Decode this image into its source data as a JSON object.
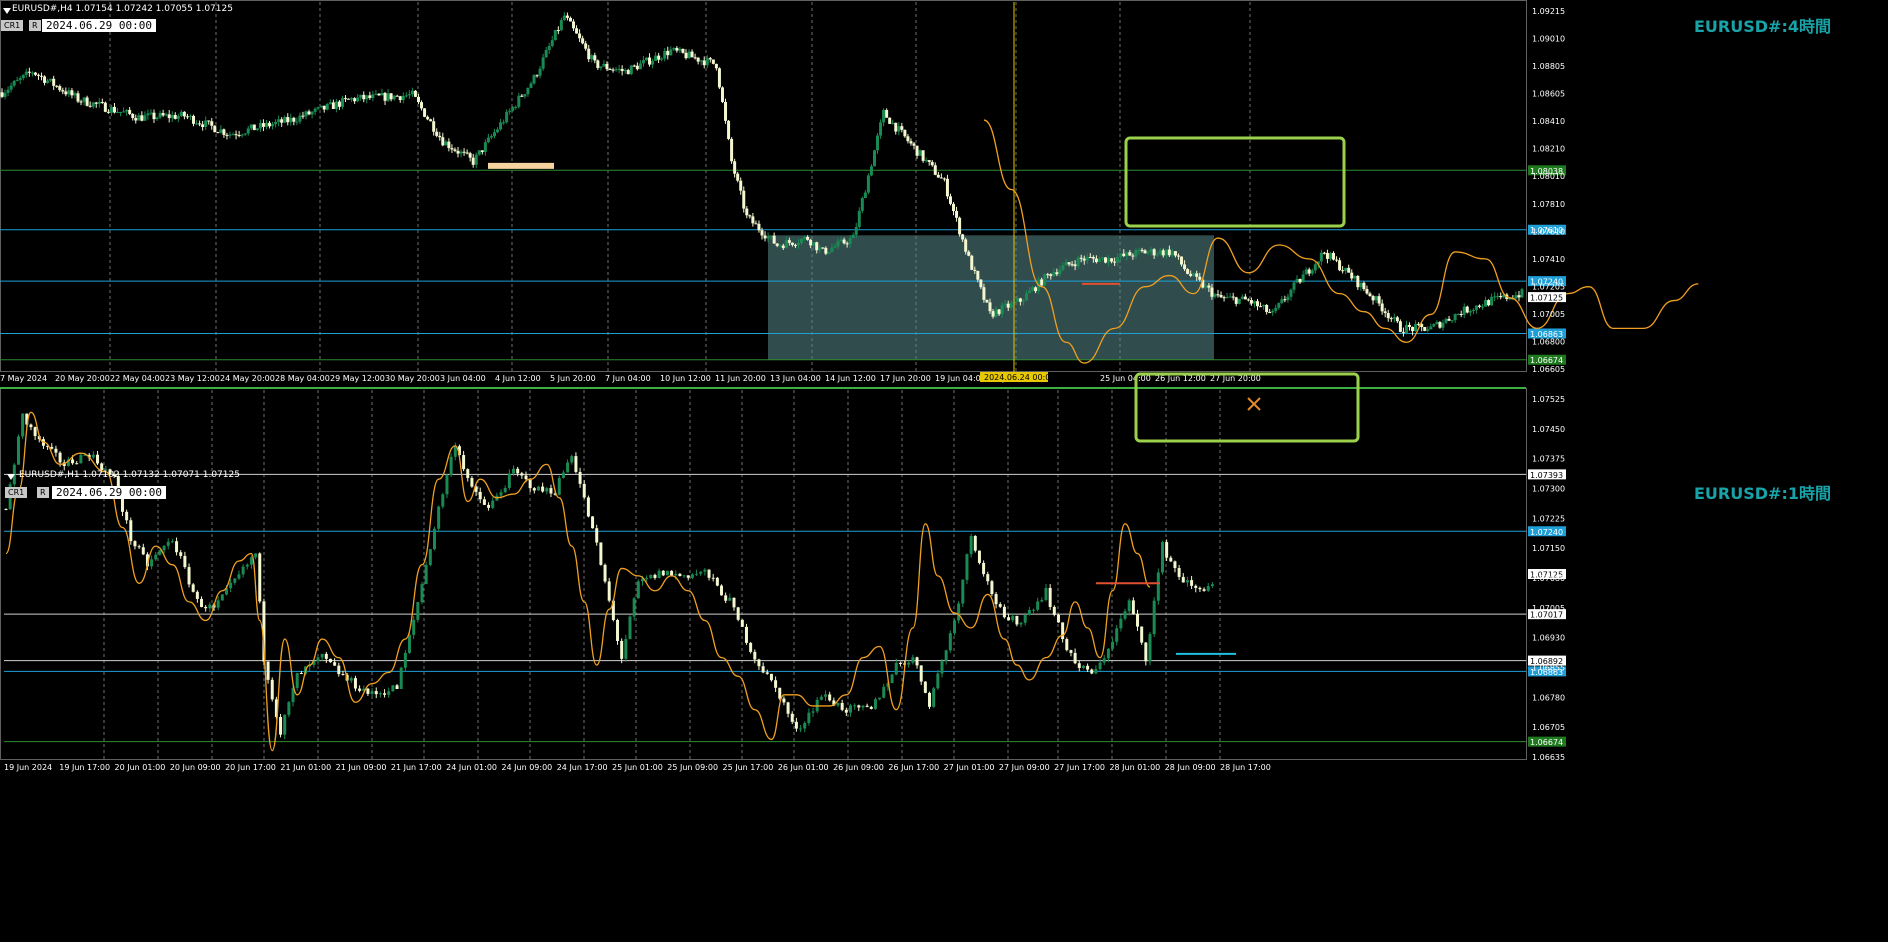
{
  "colors": {
    "background": "#000000",
    "bull": "#1a8a54",
    "bear": "#f4f7d0",
    "grid": "#8a8a8a",
    "blue_level": "#1e9fd8",
    "green_level": "#2e8b2e",
    "white_level": "#d0d0d0",
    "smooth_line": "#f0a020",
    "zone_box": "#9bd04a",
    "range_box": "#5a8a8a",
    "crosshair": "#e8c800",
    "watermark": "#17a3a8",
    "axis_text": "#ffffff"
  },
  "icons": [
    "collapse-triangle-icon",
    "crossed-pencils-icon"
  ],
  "chart_data": [
    {
      "type": "candlestick",
      "symbol_header": "EURUSD#,H4  1.07154 1.07242 1.07055 1.07125",
      "tags": [
        "CR1",
        "R"
      ],
      "date_box": "2024.06.29 00:00",
      "watermark": "EURUSD#:4時間",
      "ylim": [
        1.066,
        1.0925
      ],
      "y_ticks": [
        "1.09215",
        "1.09010",
        "1.08805",
        "1.08605",
        "1.08410",
        "1.08210",
        "1.08010",
        "1.07810",
        "1.07610",
        "1.07410",
        "1.07205",
        "1.07005",
        "1.06800",
        "1.06605"
      ],
      "x_ticks": [
        "7 May 2024",
        "20 May 20:00",
        "22 May 04:00",
        "23 May 12:00",
        "24 May 20:00",
        "28 May 04:00",
        "29 May 12:00",
        "30 May 20:00",
        "3 Jun 04:00",
        "4 Jun 12:00",
        "5 Jun 20:00",
        "7 Jun 04:00",
        "10 Jun 12:00",
        "11 Jun 20:00",
        "13 Jun 04:00",
        "14 Jun 12:00",
        "17 Jun 20:00",
        "19 Jun 04:00",
        "20 Jun",
        "2024.06.24 00:00",
        "25 Jun 04:00",
        "26 Jun 12:00",
        "27 Jun 20:00"
      ],
      "crosshair_label": "2024.06.24 00:00",
      "levels": [
        {
          "value": 1.08038,
          "label": "1.08038",
          "style": "green"
        },
        {
          "value": 1.0761,
          "label": "1.07610",
          "style": "blue"
        },
        {
          "value": 1.0724,
          "label": "1.07240",
          "style": "blue"
        },
        {
          "value": 1.06863,
          "label": "1.06863",
          "style": "blue"
        },
        {
          "value": 1.06674,
          "label": "1.06674",
          "style": "green"
        }
      ],
      "price_label": "1.07125",
      "anchors": [
        [
          0,
          1.086
        ],
        [
          10,
          1.0875
        ],
        [
          25,
          1.0855
        ],
        [
          45,
          1.0842
        ],
        [
          60,
          1.0843
        ],
        [
          75,
          1.083
        ],
        [
          95,
          1.084
        ],
        [
          115,
          1.0855
        ],
        [
          135,
          1.0858
        ],
        [
          145,
          1.0825
        ],
        [
          155,
          1.081
        ],
        [
          165,
          1.084
        ],
        [
          175,
          1.087
        ],
        [
          185,
          1.0915
        ],
        [
          195,
          1.088
        ],
        [
          205,
          1.0875
        ],
        [
          220,
          1.089
        ],
        [
          235,
          1.088
        ],
        [
          240,
          1.081
        ],
        [
          245,
          1.077
        ],
        [
          255,
          1.075
        ],
        [
          265,
          1.0755
        ],
        [
          270,
          1.0745
        ],
        [
          280,
          1.0755
        ],
        [
          290,
          1.0845
        ],
        [
          300,
          1.082
        ],
        [
          310,
          1.0795
        ],
        [
          318,
          1.074
        ],
        [
          325,
          1.07
        ],
        [
          335,
          1.071
        ],
        [
          345,
          1.073
        ],
        [
          355,
          1.074
        ],
        [
          365,
          1.074
        ],
        [
          375,
          1.0745
        ],
        [
          385,
          1.0745
        ],
        [
          390,
          1.073
        ],
        [
          400,
          1.0712
        ],
        [
          410,
          1.071
        ],
        [
          418,
          1.07
        ],
        [
          425,
          1.072
        ],
        [
          435,
          1.0745
        ],
        [
          445,
          1.0725
        ],
        [
          452,
          1.071
        ],
        [
          460,
          1.069
        ],
        [
          470,
          1.069
        ],
        [
          480,
          1.0702
        ],
        [
          490,
          1.071
        ],
        [
          500,
          1.0715
        ]
      ],
      "smooth_line": [
        [
          323,
          1.084
        ],
        [
          332,
          1.079
        ],
        [
          342,
          1.072
        ],
        [
          350,
          1.068
        ],
        [
          356,
          1.0665
        ],
        [
          366,
          1.069
        ],
        [
          376,
          1.072
        ],
        [
          384,
          1.0728
        ],
        [
          392,
          1.0715
        ],
        [
          400,
          1.0755
        ],
        [
          410,
          1.073
        ],
        [
          420,
          1.075
        ],
        [
          430,
          1.074
        ],
        [
          440,
          1.0715
        ],
        [
          448,
          1.0702
        ],
        [
          455,
          1.069
        ],
        [
          462,
          1.068
        ],
        [
          470,
          1.07
        ],
        [
          478,
          1.0745
        ],
        [
          488,
          1.074
        ],
        [
          496,
          1.0712
        ],
        [
          505,
          1.069
        ],
        [
          515,
          1.0715
        ],
        [
          522,
          1.072
        ],
        [
          530,
          1.069
        ],
        [
          540,
          1.069
        ],
        [
          550,
          1.071
        ],
        [
          558,
          1.0722
        ]
      ]
    },
    {
      "type": "candlestick",
      "symbol_header": "EURUSD#,H1  1.07102 1.07132 1.07071 1.07125",
      "tags": [
        "CR1",
        "R"
      ],
      "date_box": "2024.06.29 00:00",
      "watermark": "EURUSD#:1時間",
      "ylim": [
        1.0663,
        1.0762
      ],
      "y_ticks": [
        "1.07525",
        "1.07450",
        "1.07375",
        "1.07300",
        "1.07225",
        "1.07150",
        "1.07080",
        "1.07005",
        "1.06930",
        "1.06855",
        "1.06780",
        "1.06705",
        "1.06635"
      ],
      "x_ticks": [
        "19 Jun 2024",
        "19 Jun 17:00",
        "20 Jun 01:00",
        "20 Jun 09:00",
        "20 Jun 17:00",
        "21 Jun 01:00",
        "21 Jun 09:00",
        "21 Jun 17:00",
        "24 Jun 01:00",
        "24 Jun 09:00",
        "24 Jun 17:00",
        "25 Jun 01:00",
        "25 Jun 09:00",
        "25 Jun 17:00",
        "26 Jun 01:00",
        "26 Jun 09:00",
        "26 Jun 17:00",
        "27 Jun 01:00",
        "27 Jun 09:00",
        "27 Jun 17:00",
        "28 Jun 01:00",
        "28 Jun 09:00",
        "28 Jun 17:00"
      ],
      "levels": [
        {
          "value": 1.07393,
          "label": "1.07393",
          "style": "white"
        },
        {
          "value": 1.0724,
          "label": "1.07240",
          "style": "blue"
        },
        {
          "value": 1.07017,
          "label": "1.07017",
          "style": "white"
        },
        {
          "value": 1.06892,
          "label": "1.06892",
          "style": "white"
        },
        {
          "value": 1.06863,
          "label": "1.06863",
          "style": "blue"
        },
        {
          "value": 1.06674,
          "label": "1.06674",
          "style": "green"
        }
      ],
      "price_label": "1.07125",
      "anchors": [
        [
          0,
          1.073
        ],
        [
          4,
          1.0755
        ],
        [
          8,
          1.0748
        ],
        [
          14,
          1.0742
        ],
        [
          20,
          1.0745
        ],
        [
          26,
          1.0738
        ],
        [
          30,
          1.0722
        ],
        [
          34,
          1.0715
        ],
        [
          40,
          1.0722
        ],
        [
          46,
          1.0705
        ],
        [
          50,
          1.0703
        ],
        [
          56,
          1.0712
        ],
        [
          60,
          1.0718
        ],
        [
          62,
          1.069
        ],
        [
          66,
          1.067
        ],
        [
          70,
          1.0685
        ],
        [
          76,
          1.069
        ],
        [
          82,
          1.0684
        ],
        [
          88,
          1.068
        ],
        [
          94,
          1.0682
        ],
        [
          98,
          1.07
        ],
        [
          104,
          1.073
        ],
        [
          108,
          1.0748
        ],
        [
          112,
          1.0735
        ],
        [
          116,
          1.073
        ],
        [
          122,
          1.074
        ],
        [
          128,
          1.0735
        ],
        [
          132,
          1.0735
        ],
        [
          136,
          1.0745
        ],
        [
          142,
          1.072
        ],
        [
          148,
          1.069
        ],
        [
          152,
          1.071
        ],
        [
          158,
          1.0713
        ],
        [
          162,
          1.0712
        ],
        [
          168,
          1.0713
        ],
        [
          174,
          1.0705
        ],
        [
          180,
          1.069
        ],
        [
          186,
          1.068
        ],
        [
          190,
          1.067
        ],
        [
          196,
          1.068
        ],
        [
          202,
          1.0676
        ],
        [
          208,
          1.0676
        ],
        [
          214,
          1.0688
        ],
        [
          218,
          1.069
        ],
        [
          222,
          1.0678
        ],
        [
          228,
          1.07
        ],
        [
          232,
          1.0723
        ],
        [
          236,
          1.071
        ],
        [
          240,
          1.07
        ],
        [
          244,
          1.07
        ],
        [
          250,
          1.0708
        ],
        [
          254,
          1.0695
        ],
        [
          258,
          1.0687
        ],
        [
          262,
          1.0686
        ],
        [
          266,
          1.0695
        ],
        [
          270,
          1.0705
        ],
        [
          274,
          1.069
        ],
        [
          278,
          1.072
        ],
        [
          282,
          1.0712
        ],
        [
          286,
          1.0708
        ],
        [
          290,
          1.071
        ]
      ],
      "smooth_line": [
        [
          0,
          1.0718
        ],
        [
          3,
          1.0735
        ],
        [
          6,
          1.0756
        ],
        [
          9,
          1.0748
        ],
        [
          13,
          1.0742
        ],
        [
          18,
          1.0745
        ],
        [
          24,
          1.074
        ],
        [
          28,
          1.0725
        ],
        [
          32,
          1.071
        ],
        [
          36,
          1.072
        ],
        [
          40,
          1.0715
        ],
        [
          44,
          1.0705
        ],
        [
          48,
          1.07
        ],
        [
          52,
          1.0708
        ],
        [
          56,
          1.0716
        ],
        [
          59,
          1.0718
        ],
        [
          61,
          1.07
        ],
        [
          64,
          1.0665
        ],
        [
          67,
          1.0695
        ],
        [
          70,
          1.068
        ],
        [
          73,
          1.0688
        ],
        [
          76,
          1.0695
        ],
        [
          80,
          1.069
        ],
        [
          84,
          1.0678
        ],
        [
          88,
          1.0683
        ],
        [
          92,
          1.0686
        ],
        [
          96,
          1.0695
        ],
        [
          100,
          1.0715
        ],
        [
          104,
          1.0738
        ],
        [
          108,
          1.0747
        ],
        [
          111,
          1.0732
        ],
        [
          114,
          1.0738
        ],
        [
          118,
          1.0733
        ],
        [
          122,
          1.0734
        ],
        [
          126,
          1.0738
        ],
        [
          130,
          1.0742
        ],
        [
          133,
          1.0733
        ],
        [
          136,
          1.072
        ],
        [
          139,
          1.0705
        ],
        [
          142,
          1.0688
        ],
        [
          145,
          1.0703
        ],
        [
          148,
          1.0714
        ],
        [
          152,
          1.0712
        ],
        [
          156,
          1.0708
        ],
        [
          160,
          1.0712
        ],
        [
          164,
          1.0708
        ],
        [
          168,
          1.07
        ],
        [
          172,
          1.069
        ],
        [
          176,
          1.0685
        ],
        [
          180,
          1.0676
        ],
        [
          184,
          1.0668
        ],
        [
          187,
          1.068
        ],
        [
          190,
          1.068
        ],
        [
          194,
          1.0677
        ],
        [
          198,
          1.0677
        ],
        [
          202,
          1.068
        ],
        [
          206,
          1.069
        ],
        [
          210,
          1.0693
        ],
        [
          214,
          1.0676
        ],
        [
          218,
          1.0698
        ],
        [
          221,
          1.0726
        ],
        [
          224,
          1.0712
        ],
        [
          228,
          1.0702
        ],
        [
          232,
          1.0698
        ],
        [
          236,
          1.0707
        ],
        [
          240,
          1.0695
        ],
        [
          243,
          1.0688
        ],
        [
          246,
          1.0684
        ],
        [
          250,
          1.069
        ],
        [
          254,
          1.0696
        ],
        [
          257,
          1.0705
        ],
        [
          260,
          1.0698
        ],
        [
          263,
          1.069
        ],
        [
          266,
          1.0708
        ],
        [
          269,
          1.0726
        ],
        [
          272,
          1.0718
        ],
        [
          275,
          1.0709
        ]
      ]
    }
  ]
}
